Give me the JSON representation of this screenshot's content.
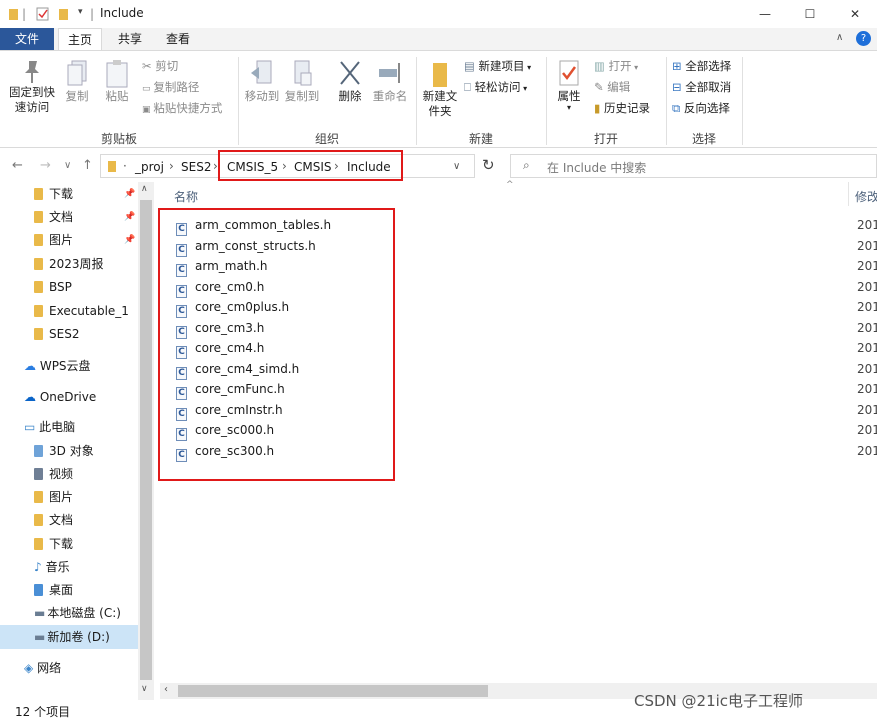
{
  "window": {
    "title": "Include",
    "minimize": "—",
    "maximize": "☐",
    "close": "✕"
  },
  "tabs": {
    "file": "文件",
    "home": "主页",
    "share": "共享",
    "view": "查看"
  },
  "ribbon": {
    "clipboard": {
      "pin_quick": "固定到快速访问",
      "copy": "复制",
      "paste": "粘贴",
      "cut": "剪切",
      "copy_path": "复制路径",
      "paste_shortcut": "粘贴快捷方式",
      "label": "剪贴板"
    },
    "organize": {
      "move_to": "移动到",
      "copy_to": "复制到",
      "delete": "删除",
      "rename": "重命名",
      "label": "组织"
    },
    "new": {
      "new_folder": "新建文件夹",
      "new_item": "新建项目",
      "easy_access": "轻松访问",
      "label": "新建"
    },
    "open": {
      "properties": "属性",
      "open": "打开",
      "edit": "编辑",
      "history": "历史记录",
      "label": "打开"
    },
    "select": {
      "select_all": "全部选择",
      "select_none": "全部取消",
      "invert": "反向选择",
      "label": "选择"
    }
  },
  "address": {
    "crumbs": [
      "_proj",
      "SES2",
      "CMSIS_5",
      "CMSIS",
      "Include"
    ],
    "search_placeholder": "在 Include 中搜索"
  },
  "nav": {
    "quick": [
      {
        "label": "下载",
        "pinned": true
      },
      {
        "label": "文档",
        "pinned": true
      },
      {
        "label": "图片",
        "pinned": true
      },
      {
        "label": "2023周报",
        "pinned": false
      },
      {
        "label": "BSP",
        "pinned": false
      },
      {
        "label": "Executable_1",
        "pinned": false
      },
      {
        "label": "SES2",
        "pinned": false
      }
    ],
    "wps": "WPS云盘",
    "onedrive": "OneDrive",
    "thispc": "此电脑",
    "pc_items": [
      "3D 对象",
      "视频",
      "图片",
      "文档",
      "下载",
      "音乐",
      "桌面",
      "本地磁盘 (C:)",
      "新加卷 (D:)"
    ],
    "network": "网络"
  },
  "filelist": {
    "col_name": "名称",
    "col_date": "修改",
    "files": [
      {
        "name": "arm_common_tables.h",
        "date": "201"
      },
      {
        "name": "arm_const_structs.h",
        "date": "201"
      },
      {
        "name": "arm_math.h",
        "date": "201"
      },
      {
        "name": "core_cm0.h",
        "date": "201"
      },
      {
        "name": "core_cm0plus.h",
        "date": "201"
      },
      {
        "name": "core_cm3.h",
        "date": "201"
      },
      {
        "name": "core_cm4.h",
        "date": "201"
      },
      {
        "name": "core_cm4_simd.h",
        "date": "201"
      },
      {
        "name": "core_cmFunc.h",
        "date": "201"
      },
      {
        "name": "core_cmInstr.h",
        "date": "201"
      },
      {
        "name": "core_sc000.h",
        "date": "201"
      },
      {
        "name": "core_sc300.h",
        "date": "201"
      }
    ]
  },
  "status": {
    "count": "12 个项目"
  },
  "watermark": "CSDN @21ic电子工程师"
}
